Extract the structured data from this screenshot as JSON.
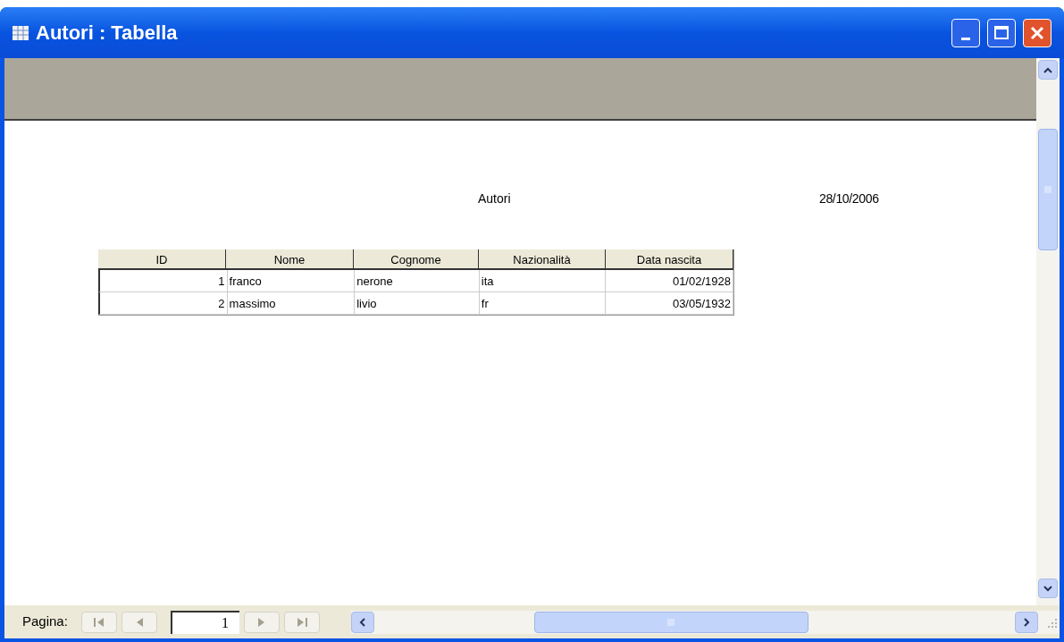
{
  "window": {
    "title": "Autori : Tabella"
  },
  "report": {
    "title": "Autori",
    "date": "28/10/2006",
    "table": {
      "columns": [
        "ID",
        "Nome",
        "Cognome",
        "Nazionalità",
        "Data nascita"
      ],
      "rows": [
        [
          "1",
          "franco",
          "nerone",
          "ita",
          "01/02/1928"
        ],
        [
          "2",
          "massimo",
          "livio",
          "fr",
          "03/05/1932"
        ]
      ]
    }
  },
  "navigation": {
    "label": "Pagina:",
    "page": "1"
  }
}
